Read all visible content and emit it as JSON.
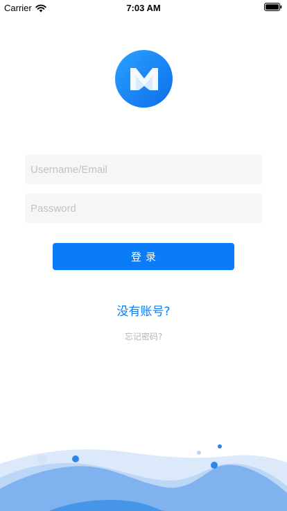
{
  "status_bar": {
    "carrier": "Carrier",
    "time": "7:03 AM",
    "icons": [
      "wifi-icon",
      "battery-icon"
    ]
  },
  "app": {
    "logo": "app-logo-icon",
    "brand_color": "#0a7cf7"
  },
  "login_form": {
    "username_placeholder": "Username/Email",
    "username_value": "",
    "password_placeholder": "Password",
    "password_value": "",
    "login_label": "登录"
  },
  "links": {
    "register": "没有账号?",
    "forgot_password": "忘记密码?"
  },
  "decoration": {
    "wave_colors": [
      "#dbe9fb",
      "#bcd7f6",
      "#7fb2ee",
      "#3d8fe8"
    ]
  }
}
